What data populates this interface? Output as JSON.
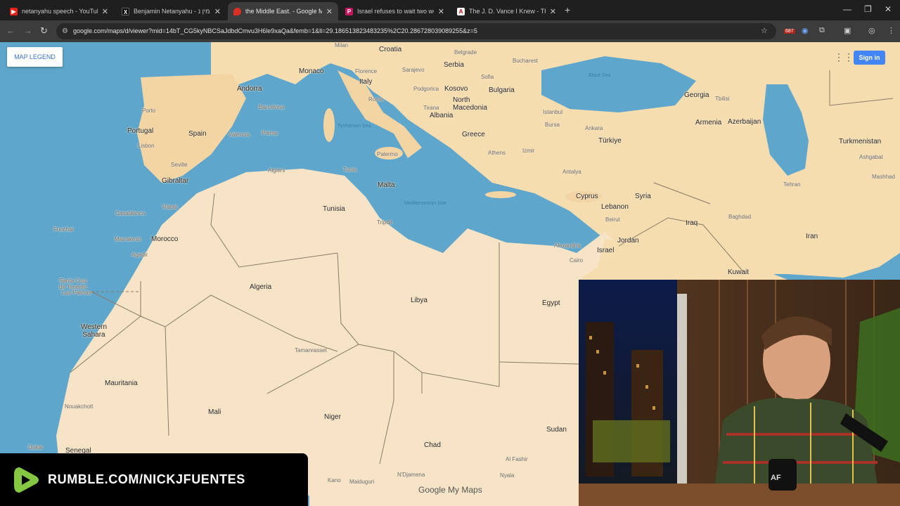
{
  "browser": {
    "tabs": [
      {
        "title": "netanyahu speech - YouTube",
        "icon": "youtube-icon",
        "active": false
      },
      {
        "title": "Benjamin Netanyahu - בנימין נ",
        "icon": "x-icon",
        "active": false
      },
      {
        "title": "the Middle East. - Google My M",
        "icon": "maps-pin-icon",
        "active": true
      },
      {
        "title": "Israel refuses to wait two weeks",
        "icon": "politico-icon",
        "active": false
      },
      {
        "title": "The J. D. Vance I Knew - The Atl",
        "icon": "atlantic-icon",
        "active": false
      }
    ],
    "url": "google.com/maps/d/viewer?mid=14bT_CG5kyNBCSaJdbdCmvu3H6le9xaQa&femb=1&ll=29.186513823483235%2C20.286728039089255&z=5",
    "extension_badge": "687"
  },
  "map": {
    "legend_button": "MAP LEGEND",
    "signin_button": "Sign in",
    "attribution": "Google My Maps",
    "countries": [
      {
        "t": "Croatia"
      },
      {
        "t": "Serbia"
      },
      {
        "t": "Monaco"
      },
      {
        "t": "Andorra"
      },
      {
        "t": "Italy"
      },
      {
        "t": "Kosovo"
      },
      {
        "t": "Bulgaria"
      },
      {
        "t": "North Macedonia"
      },
      {
        "t": "Albania"
      },
      {
        "t": "Georgia"
      },
      {
        "t": "Armenia"
      },
      {
        "t": "Azerbaijan"
      },
      {
        "t": "Portugal"
      },
      {
        "t": "Spain"
      },
      {
        "t": "Greece"
      },
      {
        "t": "Türkiye"
      },
      {
        "t": "Turkmenistan"
      },
      {
        "t": "Gibraltar"
      },
      {
        "t": "Malta"
      },
      {
        "t": "Tunisia"
      },
      {
        "t": "Cyprus"
      },
      {
        "t": "Syria"
      },
      {
        "t": "Lebanon"
      },
      {
        "t": "Morocco"
      },
      {
        "t": "Iraq"
      },
      {
        "t": "Jordan"
      },
      {
        "t": "Israel"
      },
      {
        "t": "Iran"
      },
      {
        "t": "Kuwait"
      },
      {
        "t": "Algeria"
      },
      {
        "t": "Libya"
      },
      {
        "t": "Egypt"
      },
      {
        "t": "Western Sahara"
      },
      {
        "t": "Mauritania"
      },
      {
        "t": "Mali"
      },
      {
        "t": "Niger"
      },
      {
        "t": "Chad"
      },
      {
        "t": "Sudan"
      },
      {
        "t": "Senegal"
      }
    ],
    "cities": [
      {
        "t": "Milan"
      },
      {
        "t": "Florence"
      },
      {
        "t": "Sarajevo"
      },
      {
        "t": "Belgrade"
      },
      {
        "t": "Bucharest"
      },
      {
        "t": "Rome"
      },
      {
        "t": "Podgorica"
      },
      {
        "t": "Sofia"
      },
      {
        "t": "Porto"
      },
      {
        "t": "Barcelona"
      },
      {
        "t": "Tirana"
      },
      {
        "t": "Istanbul"
      },
      {
        "t": "Tbilisi"
      },
      {
        "t": "Lisbon"
      },
      {
        "t": "Valencia"
      },
      {
        "t": "Palma"
      },
      {
        "t": "Bursa"
      },
      {
        "t": "Ankara"
      },
      {
        "t": "Athens"
      },
      {
        "t": "Izmir"
      },
      {
        "t": "Seville"
      },
      {
        "t": "Palermo"
      },
      {
        "t": "Antalya"
      },
      {
        "t": "Algiers"
      },
      {
        "t": "Tunis"
      },
      {
        "t": "Tehran"
      },
      {
        "t": "Ashgabat"
      },
      {
        "t": "Mashhad"
      },
      {
        "t": "Rabat"
      },
      {
        "t": "Casablanca"
      },
      {
        "t": "Tripoli"
      },
      {
        "t": "Beirut"
      },
      {
        "t": "Funchal"
      },
      {
        "t": "Marrakesh"
      },
      {
        "t": "Agadir"
      },
      {
        "t": "Baghdad"
      },
      {
        "t": "Alexandria"
      },
      {
        "t": "Cairo"
      },
      {
        "t": "Santa Cruz de Tenerife"
      },
      {
        "t": "Las Palmas"
      },
      {
        "t": "Tamanrasset"
      },
      {
        "t": "Nouakchott"
      },
      {
        "t": "Dakar"
      },
      {
        "t": "N'Djamena"
      },
      {
        "t": "Kano"
      },
      {
        "t": "Maiduguri"
      },
      {
        "t": "Al Fashir"
      },
      {
        "t": "Nyala"
      }
    ],
    "seas": [
      {
        "t": "Black Sea"
      },
      {
        "t": "Tyrrhenian Sea"
      },
      {
        "t": "Mediterranean Sea"
      }
    ]
  },
  "overlay": {
    "rumble_url": "RUMBLE.COM/NICKJFUENTES",
    "watermark": "AF"
  }
}
